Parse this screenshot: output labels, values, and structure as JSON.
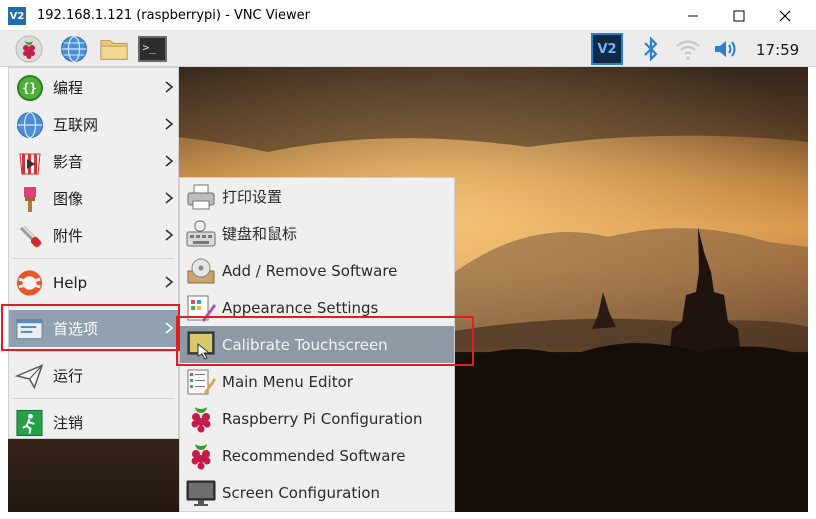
{
  "window": {
    "logo_text": "V2",
    "title": "192.168.1.121 (raspberrypi) - VNC Viewer",
    "minimize_glyph": "—",
    "maximize_glyph": "☐",
    "close_glyph": "✕"
  },
  "panel": {
    "vnc_badge": "V2",
    "clock": "17:59",
    "icons": [
      "raspberry-icon",
      "globe-icon",
      "folder-icon",
      "terminal-icon",
      "vnc-icon",
      "bluetooth-icon",
      "wifi-icon",
      "volume-icon"
    ],
    "terminal_glyph": ">_"
  },
  "main_menu": {
    "items": [
      {
        "label": "编程",
        "icon": "programming-icon",
        "has_submenu": true
      },
      {
        "label": "互联网",
        "icon": "internet-icon",
        "has_submenu": true
      },
      {
        "label": "影音",
        "icon": "sound-video-icon",
        "has_submenu": true
      },
      {
        "label": "图像",
        "icon": "graphics-icon",
        "has_submenu": true
      },
      {
        "label": "附件",
        "icon": "accessories-icon",
        "has_submenu": true
      },
      {
        "label": "Help",
        "icon": "help-icon",
        "has_submenu": true
      },
      {
        "label": "首选项",
        "icon": "preferences-icon",
        "has_submenu": true,
        "highlighted": true
      },
      {
        "label": "运行",
        "icon": "run-icon",
        "has_submenu": false
      },
      {
        "label": "注销",
        "icon": "logout-icon",
        "has_submenu": false
      }
    ],
    "programming_glyph": "{}"
  },
  "sub_menu": {
    "items": [
      {
        "label": "打印设置",
        "icon": "printer-icon"
      },
      {
        "label": "键盘和鼠标",
        "icon": "keyboard-mouse-icon"
      },
      {
        "label": "Add / Remove Software",
        "icon": "software-disc-icon"
      },
      {
        "label": "Appearance Settings",
        "icon": "appearance-icon"
      },
      {
        "label": "Calibrate Touchscreen",
        "icon": "touchscreen-icon",
        "highlighted": true
      },
      {
        "label": "Main Menu Editor",
        "icon": "menu-editor-icon"
      },
      {
        "label": "Raspberry Pi Configuration",
        "icon": "raspberry-icon"
      },
      {
        "label": "Recommended Software",
        "icon": "raspberry-icon"
      },
      {
        "label": "Screen Configuration",
        "icon": "monitor-icon"
      }
    ]
  },
  "colors": {
    "menu_bg": "#efefef",
    "highlight": "#8fa1ae",
    "annotation_red": "#e02020",
    "vnc_blue": "#1f6fb5"
  }
}
